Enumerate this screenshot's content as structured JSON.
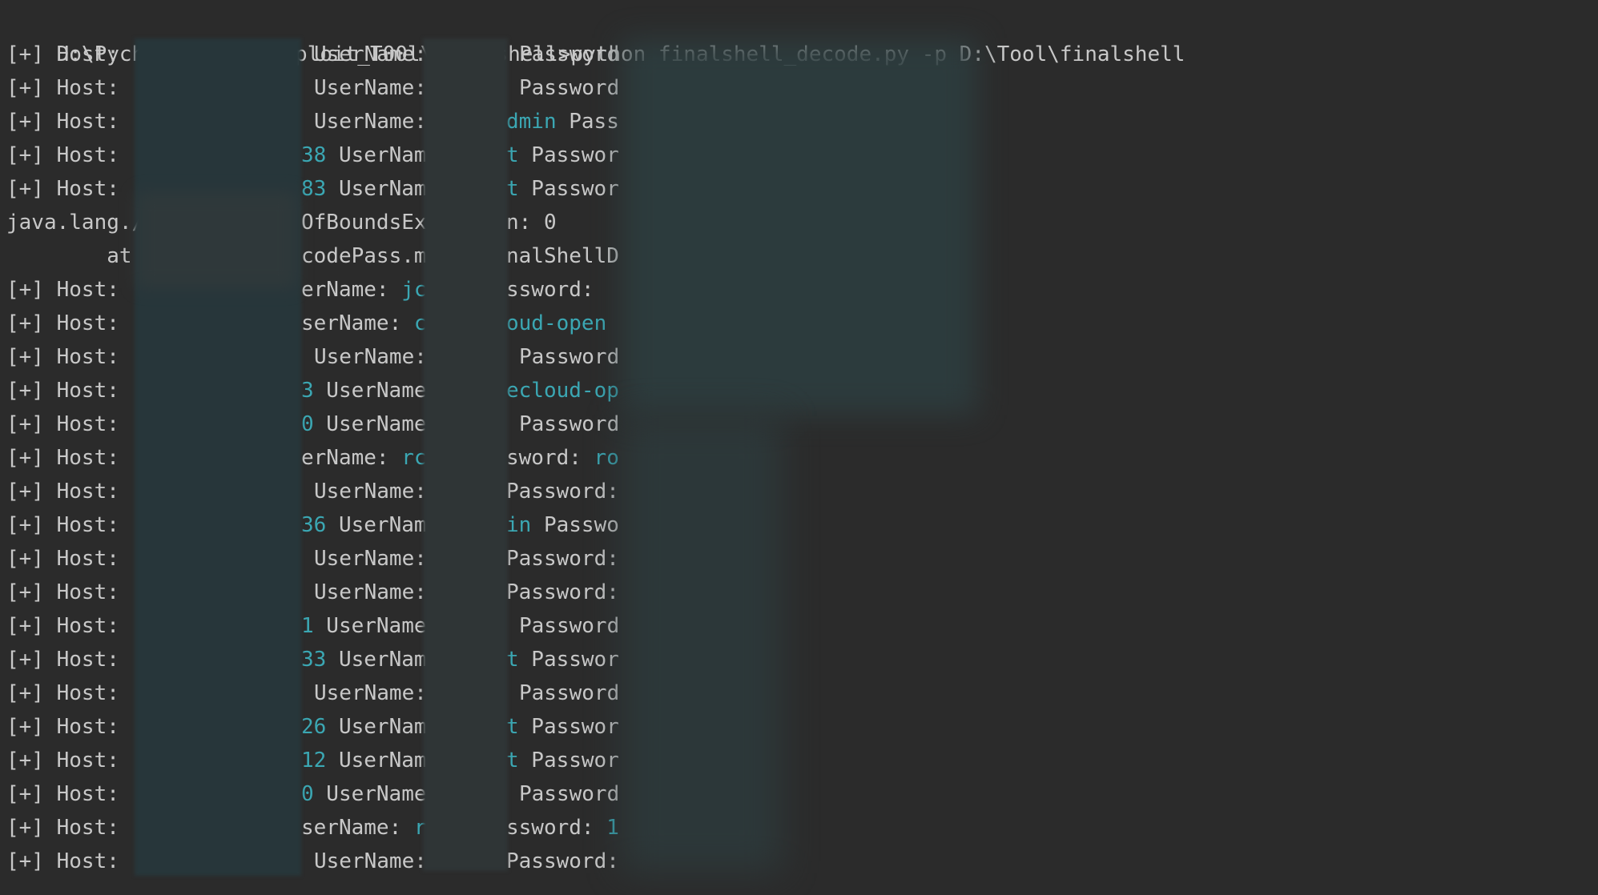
{
  "terminal": {
    "command_line": "D:\\PycharmProject\\Sploit_T00l\\finalshell>python finalshell_decode.py -p D:\\Tool\\finalshell",
    "rows": [
      {
        "a": "[+] Host: ",
        "b": "",
        "c": "UserName:",
        "d": "",
        "e": "Password"
      },
      {
        "a": "[+] Host: ",
        "b": "",
        "c": "UserName:",
        "d": "",
        "e": "Password"
      },
      {
        "a": "[+] Host: ",
        "b": "",
        "c": "UserName:",
        "d": "dmin",
        "e": " Pass"
      },
      {
        "a": "[+] Host: ",
        "b": "38",
        "c": " UserNam",
        "d": "t",
        "e": " Passwor"
      },
      {
        "a": "[+] Host: ",
        "b": "83",
        "c": " UserNam",
        "d": "t",
        "e": " Passwor"
      },
      {
        "a": "java.lang./",
        "b": "",
        "c": "OfBoundsEx",
        "d": "",
        "e": "n: 0"
      },
      {
        "a": "        at",
        "b": "",
        "c": "codePass.m",
        "d": "",
        "e": "nalShellD"
      },
      {
        "a": "[+] Host: ",
        "b": "",
        "c": "erName: ",
        "c2": "jc",
        "d": "",
        "e": "ssword:"
      },
      {
        "a": "[+] Host: ",
        "b": "",
        "c": "serName: ",
        "c2": "c",
        "d": "oud-open",
        "e": ""
      },
      {
        "a": "[+] Host: ",
        "b": "",
        "c": "UserName:",
        "d": "",
        "e": "Password"
      },
      {
        "a": "[+] Host: ",
        "b": "3",
        "c": " UserName",
        "d": "ecloud-op",
        "e": ""
      },
      {
        "a": "[+] Host: ",
        "b": "0",
        "c": " UserName",
        "d": "",
        "e": "Password"
      },
      {
        "a": "[+] Host: ",
        "b": "",
        "c": "erName: ",
        "c2": "rc",
        "d": "",
        "e": "sword: ",
        "e2": "ro"
      },
      {
        "a": "[+] Host: ",
        "b": "",
        "c": "UserName:",
        "d": "",
        "e": "Password:"
      },
      {
        "a": "[+] Host: ",
        "b": "36",
        "c": " UserNam",
        "d": "in",
        "e": " Passwo"
      },
      {
        "a": "[+] Host: ",
        "b": "",
        "c": "UserName:",
        "d": "",
        "e": "Password:"
      },
      {
        "a": "[+] Host: ",
        "b": "",
        "c": "UserName:",
        "d": "",
        "e": "Password:"
      },
      {
        "a": "[+] Host: ",
        "b": "1",
        "c": " UserName",
        "d": "",
        "e": "Password"
      },
      {
        "a": "[+] Host: ",
        "b": "33",
        "c": " UserNam",
        "d": "t",
        "e": " Passwor"
      },
      {
        "a": "[+] Host: ",
        "b": "",
        "c": "UserName:",
        "d": "",
        "e": "Password"
      },
      {
        "a": "[+] Host: ",
        "b": "26",
        "c": " UserNam",
        "d": "t",
        "e": " Passwor"
      },
      {
        "a": "[+] Host: ",
        "b": "12",
        "c": " UserNam",
        "d": "t",
        "e": " Passwor"
      },
      {
        "a": "[+] Host: ",
        "b": "0",
        "c": " UserName",
        "d": "",
        "e": "Password"
      },
      {
        "a": "[+] Host: ",
        "b": "",
        "c": "serName: ",
        "c2": "r",
        "d": "",
        "e": "ssword: ",
        "e2": "1"
      },
      {
        "a": "[+] Host: ",
        "b": "",
        "c": "UserName:",
        "d": "",
        "e": "Password:"
      }
    ]
  },
  "colors": {
    "background": "#2b2b2b",
    "text": "#c8c8c8",
    "accent_cyan": "#3ba7b3"
  }
}
